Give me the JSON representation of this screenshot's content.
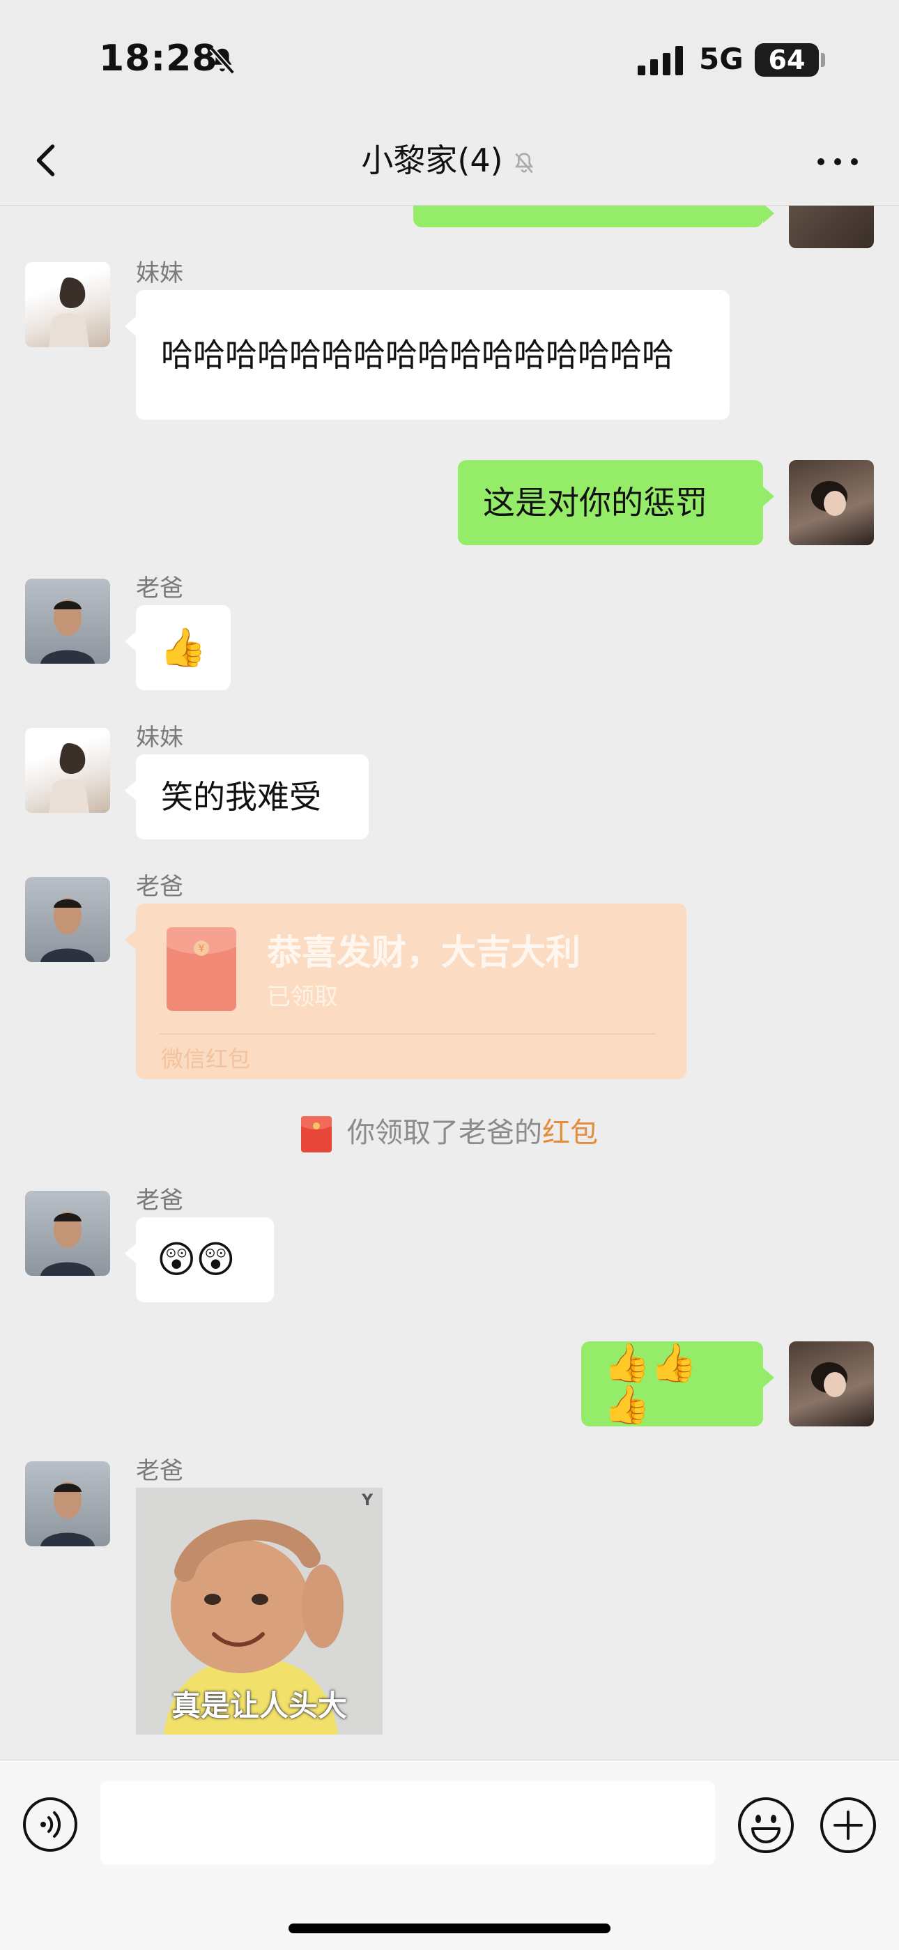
{
  "status_bar": {
    "time": "18:28",
    "network": "5G",
    "battery": "64"
  },
  "nav": {
    "title": "小黎家(4)"
  },
  "messages": [
    {
      "sender": "妹妹",
      "text": "哈哈哈哈哈哈哈哈哈哈哈哈哈哈哈哈"
    },
    {
      "sender": "",
      "text": "这是对你的惩罚"
    },
    {
      "sender": "老爸",
      "text": "👍"
    },
    {
      "sender": "妹妹",
      "text": "笑的我难受"
    },
    {
      "sender": "老爸",
      "red_packet": {
        "title": "恭喜发财，大吉大利",
        "status": "已领取",
        "footer": "微信红包"
      }
    },
    {
      "system": {
        "prefix": "你领取了老爸的",
        "link": "红包"
      }
    },
    {
      "sender": "老爸",
      "text": "😲😲"
    },
    {
      "sender": "",
      "text": "👍👍👍"
    },
    {
      "sender": "老爸",
      "sticker": {
        "caption": "真是让人头大",
        "mark": "Y"
      }
    }
  ],
  "icons": [
    "bell-off-icon",
    "back-icon",
    "more-icon",
    "voice-icon",
    "emoji-icon",
    "plus-icon",
    "red-packet-icon"
  ],
  "colors": {
    "outgoing_bubble": "#95ec69",
    "incoming_bubble": "#ffffff",
    "background": "#ededed",
    "red_packet": "#fbdcc3",
    "link": "#e48b3c"
  }
}
